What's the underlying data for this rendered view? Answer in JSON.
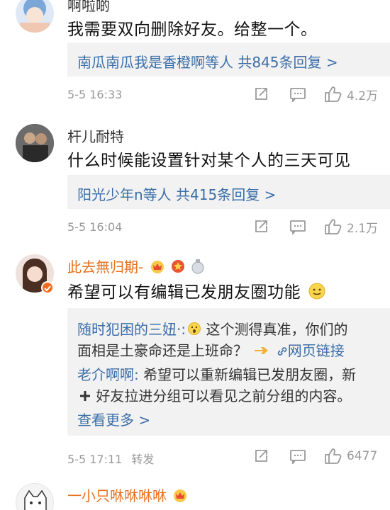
{
  "comments": [
    {
      "name": "啊啦啲",
      "text": "我需要双向删除好友。给整一个。",
      "reply_summary": "南瓜南瓜我是香橙啊等人 共845条回复 >",
      "time": "5-5 16:33",
      "likes": "4.2万"
    },
    {
      "name": "杆儿耐特",
      "text": "什么时候能设置针对某个人的三天可见",
      "reply_summary": "阳光少年n等人 共415条回复 >",
      "time": "5-5 16:04",
      "likes": "2.1万"
    },
    {
      "name": "此去無归期-",
      "text": "希望可以有编辑已发朋友圈功能",
      "replies": [
        {
          "user": "随时犯困的三妞·:",
          "line1": " 这个测得真准，你们的",
          "line2": "面相是土豪命还是上班命？",
          "link": "网页链接"
        },
        {
          "user": "老介啊啊:",
          "line1": " 希望可以重新编辑已发朋友圈，新",
          "line2": "好友拉进分组可以看见之前分组的内容。"
        }
      ],
      "view_more": "查看更多 >",
      "time": "5-5 17:11",
      "forward": "转发",
      "likes": "6477"
    },
    {
      "name": "一小只咻咻咻咻"
    }
  ],
  "colors": {
    "link": "#3b6ea8",
    "vip_name": "#e8711f",
    "meta": "#999999",
    "reply_bg": "#f2f2f2"
  },
  "icons": [
    "share-icon",
    "comment-icon",
    "like-icon",
    "smile-emoji-icon",
    "vip-crown-icon"
  ]
}
